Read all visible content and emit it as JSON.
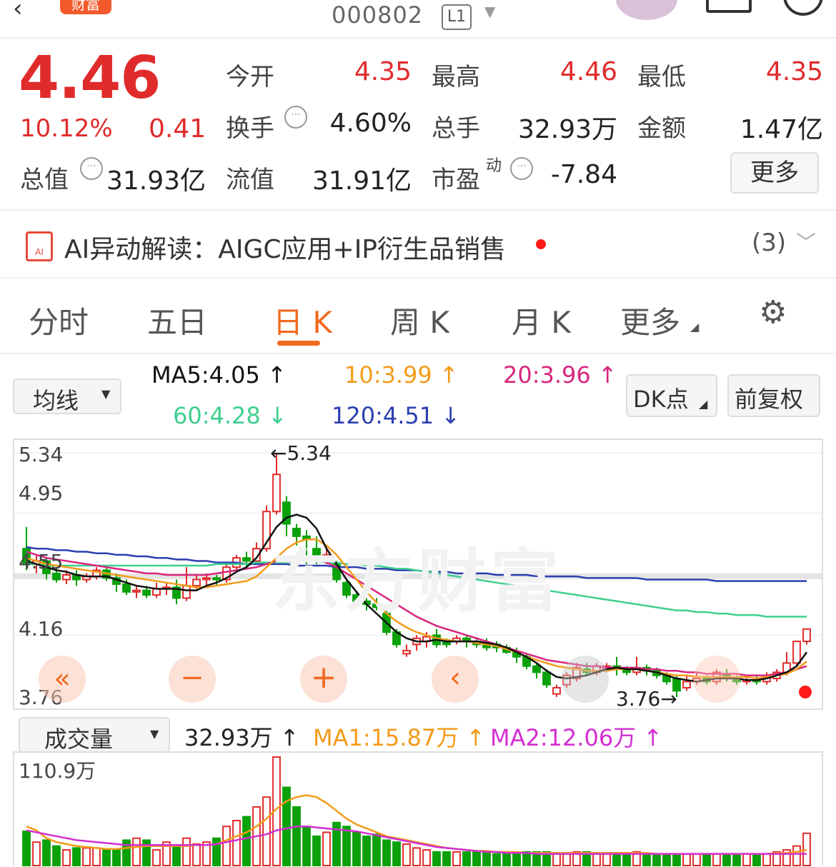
{
  "header": {
    "code": "000802",
    "level": "L1",
    "logo": "财富"
  },
  "quote": {
    "price": "4.46",
    "change_pct": "10.12%",
    "change": "0.41",
    "open_label": "今开",
    "open": "4.35",
    "high_label": "最高",
    "high": "4.46",
    "low_label": "最低",
    "low": "4.35",
    "turnover_label": "换手",
    "turnover": "4.60%",
    "volume_label": "总手",
    "volume": "32.93万",
    "amount_label": "金额",
    "amount": "1.47亿",
    "mktcap_label": "总值",
    "mktcap": "31.93亿",
    "float_label": "流值",
    "float_cap": "31.91亿",
    "pe_label": "市盈",
    "pe_sup": "动",
    "pe": "-7.84",
    "more": "更多"
  },
  "ai": {
    "label": "AI异动解读：",
    "text": "AIGC应用+IP衍生品销售",
    "count": "(3)"
  },
  "tabs": [
    "分时",
    "五日",
    "日 K",
    "周 K",
    "月 K",
    "更多"
  ],
  "active_tab": 2,
  "ma_bar": {
    "selector": "均线",
    "ma5": "MA5:4.05 ↑",
    "ma10": "10:3.99 ↑",
    "ma20": "20:3.96 ↑",
    "ma60": "60:4.28 ↓",
    "ma120": "120:4.51 ↓",
    "dk": "DK点",
    "fq": "前复权"
  },
  "price_axis": [
    "5.34",
    "4.95",
    "4.55",
    "4.16",
    "3.76"
  ],
  "price_annotations": {
    "high": "←5.34",
    "low": "3.76→"
  },
  "watermark": "东方财富",
  "volume_bar": {
    "selector": "成交量",
    "vol": "32.93万 ↑",
    "ma1": "MA1:15.87万 ↑",
    "ma2": "MA2:12.06万 ↑",
    "axis_max": "110.9万"
  },
  "colors": {
    "up": "#e02b2b",
    "down": "#0aa10a",
    "accent": "#f06a1f",
    "ma5": "#111111",
    "ma10": "#f39b19",
    "ma20": "#d8257e",
    "ma60": "#3fcf8e",
    "ma120": "#2b3fb0"
  },
  "chart_data": {
    "type": "candlestick",
    "ylim": [
      3.76,
      5.34
    ],
    "candles": [
      [
        4.72,
        4.62,
        4.86,
        4.58
      ],
      [
        4.62,
        4.64,
        4.68,
        4.56
      ],
      [
        4.64,
        4.56,
        4.66,
        4.52
      ],
      [
        4.56,
        4.52,
        4.6,
        4.5
      ],
      [
        4.52,
        4.55,
        4.58,
        4.49
      ],
      [
        4.55,
        4.52,
        4.58,
        4.48
      ],
      [
        4.52,
        4.54,
        4.56,
        4.5
      ],
      [
        4.54,
        4.58,
        4.6,
        4.52
      ],
      [
        4.58,
        4.53,
        4.6,
        4.51
      ],
      [
        4.53,
        4.49,
        4.56,
        4.44
      ],
      [
        4.49,
        4.44,
        4.52,
        4.42
      ],
      [
        4.44,
        4.45,
        4.48,
        4.4
      ],
      [
        4.45,
        4.42,
        4.48,
        4.4
      ],
      [
        4.42,
        4.46,
        4.5,
        4.4
      ],
      [
        4.46,
        4.47,
        4.5,
        4.42
      ],
      [
        4.47,
        4.4,
        4.52,
        4.36
      ],
      [
        4.4,
        4.48,
        4.6,
        4.38
      ],
      [
        4.48,
        4.52,
        4.55,
        4.46
      ],
      [
        4.52,
        4.53,
        4.56,
        4.48
      ],
      [
        4.53,
        4.52,
        4.55,
        4.48
      ],
      [
        4.52,
        4.6,
        4.62,
        4.5
      ],
      [
        4.6,
        4.66,
        4.68,
        4.58
      ],
      [
        4.66,
        4.64,
        4.7,
        4.6
      ],
      [
        4.64,
        4.72,
        4.76,
        4.62
      ],
      [
        4.72,
        4.96,
        5.0,
        4.7
      ],
      [
        4.96,
        5.2,
        5.34,
        4.94
      ],
      [
        5.02,
        4.88,
        5.06,
        4.8
      ],
      [
        4.85,
        4.8,
        4.88,
        4.74
      ],
      [
        4.8,
        4.78,
        4.84,
        4.62
      ],
      [
        4.72,
        4.66,
        4.8,
        4.62
      ],
      [
        4.66,
        4.68,
        4.72,
        4.62
      ],
      [
        4.62,
        4.52,
        4.64,
        4.5
      ],
      [
        4.5,
        4.42,
        4.52,
        4.4
      ],
      [
        4.42,
        4.38,
        4.44,
        4.36
      ],
      [
        4.38,
        4.36,
        4.4,
        4.32
      ],
      [
        4.36,
        4.34,
        4.4,
        4.32
      ],
      [
        4.3,
        4.18,
        4.32,
        4.16
      ],
      [
        4.18,
        4.1,
        4.2,
        4.08
      ],
      [
        4.04,
        4.06,
        4.1,
        4.02
      ],
      [
        4.1,
        4.14,
        4.16,
        4.06
      ],
      [
        4.12,
        4.15,
        4.18,
        4.08
      ],
      [
        4.16,
        4.1,
        4.2,
        4.08
      ],
      [
        4.12,
        4.1,
        4.14,
        4.08
      ],
      [
        4.12,
        4.14,
        4.16,
        4.1
      ],
      [
        4.14,
        4.12,
        4.16,
        4.08
      ],
      [
        4.12,
        4.1,
        4.14,
        4.08
      ],
      [
        4.1,
        4.08,
        4.14,
        4.06
      ],
      [
        4.1,
        4.08,
        4.12,
        4.05
      ],
      [
        4.08,
        4.05,
        4.1,
        4.04
      ],
      [
        4.05,
        4.02,
        4.08,
        3.98
      ],
      [
        4.02,
        3.96,
        4.04,
        3.94
      ],
      [
        3.96,
        3.92,
        3.98,
        3.88
      ],
      [
        3.92,
        3.84,
        3.94,
        3.82
      ],
      [
        3.78,
        3.82,
        3.84,
        3.76
      ],
      [
        3.84,
        3.9,
        3.92,
        3.82
      ],
      [
        3.88,
        3.95,
        3.98,
        3.86
      ],
      [
        3.94,
        3.92,
        3.98,
        3.9
      ],
      [
        3.92,
        3.96,
        3.98,
        3.9
      ],
      [
        3.94,
        3.96,
        3.98,
        3.92
      ],
      [
        3.96,
        3.94,
        4.02,
        3.9
      ],
      [
        3.94,
        3.92,
        3.96,
        3.9
      ],
      [
        3.92,
        3.95,
        4.02,
        3.9
      ],
      [
        3.95,
        3.93,
        3.97,
        3.9
      ],
      [
        3.93,
        3.9,
        3.95,
        3.88
      ],
      [
        3.9,
        3.86,
        3.92,
        3.84
      ],
      [
        3.88,
        3.8,
        3.9,
        3.76
      ],
      [
        3.82,
        3.86,
        3.9,
        3.8
      ],
      [
        3.86,
        3.88,
        3.92,
        3.84
      ],
      [
        3.88,
        3.86,
        3.9,
        3.84
      ],
      [
        3.86,
        3.92,
        3.94,
        3.84
      ],
      [
        3.9,
        3.88,
        3.94,
        3.86
      ],
      [
        3.88,
        3.86,
        3.9,
        3.84
      ],
      [
        3.86,
        3.87,
        3.9,
        3.84
      ],
      [
        3.87,
        3.86,
        3.9,
        3.84
      ],
      [
        3.86,
        3.9,
        3.92,
        3.84
      ],
      [
        3.88,
        3.92,
        3.94,
        3.86
      ],
      [
        3.92,
        3.98,
        4.05,
        3.9
      ],
      [
        3.98,
        4.12,
        4.12,
        3.96
      ],
      [
        4.12,
        4.2,
        4.2,
        4.1
      ]
    ],
    "ma5": [
      4.64,
      4.62,
      4.6,
      4.58,
      4.57,
      4.55,
      4.54,
      4.54,
      4.54,
      4.52,
      4.5,
      4.48,
      4.47,
      4.46,
      4.46,
      4.46,
      4.45,
      4.45,
      4.48,
      4.5,
      4.53,
      4.57,
      4.6,
      4.66,
      4.76,
      4.86,
      4.92,
      4.94,
      4.92,
      4.85,
      4.72,
      4.62,
      4.52,
      4.44,
      4.36,
      4.3,
      4.24,
      4.18,
      4.14,
      4.12,
      4.12,
      4.13,
      4.12,
      4.12,
      4.12,
      4.12,
      4.11,
      4.1,
      4.08,
      4.05,
      4.02,
      3.98,
      3.93,
      3.89,
      3.88,
      3.89,
      3.9,
      3.92,
      3.94,
      3.95,
      3.94,
      3.94,
      3.93,
      3.92,
      3.9,
      3.88,
      3.87,
      3.86,
      3.87,
      3.88,
      3.88,
      3.88,
      3.87,
      3.87,
      3.88,
      3.9,
      3.92,
      3.96,
      4.05
    ],
    "ma10": [
      4.66,
      4.64,
      4.62,
      4.61,
      4.6,
      4.59,
      4.58,
      4.57,
      4.56,
      4.55,
      4.54,
      4.53,
      4.52,
      4.51,
      4.5,
      4.49,
      4.48,
      4.47,
      4.47,
      4.48,
      4.49,
      4.5,
      4.51,
      4.54,
      4.6,
      4.66,
      4.72,
      4.76,
      4.78,
      4.78,
      4.74,
      4.68,
      4.6,
      4.52,
      4.44,
      4.37,
      4.3,
      4.25,
      4.21,
      4.18,
      4.16,
      4.14,
      4.13,
      4.12,
      4.12,
      4.11,
      4.1,
      4.09,
      4.07,
      4.05,
      4.02,
      4.0,
      3.98,
      3.96,
      3.95,
      3.94,
      3.93,
      3.93,
      3.93,
      3.94,
      3.94,
      3.94,
      3.93,
      3.92,
      3.91,
      3.9,
      3.9,
      3.89,
      3.89,
      3.89,
      3.89,
      3.89,
      3.89,
      3.88,
      3.89,
      3.9,
      3.91,
      3.94,
      3.99
    ],
    "ma20": [
      4.7,
      4.68,
      4.66,
      4.65,
      4.64,
      4.63,
      4.62,
      4.61,
      4.6,
      4.59,
      4.58,
      4.57,
      4.56,
      4.56,
      4.55,
      4.55,
      4.55,
      4.55,
      4.55,
      4.56,
      4.57,
      4.58,
      4.59,
      4.6,
      4.62,
      4.64,
      4.66,
      4.66,
      4.66,
      4.65,
      4.63,
      4.6,
      4.56,
      4.52,
      4.48,
      4.44,
      4.4,
      4.36,
      4.32,
      4.28,
      4.25,
      4.22,
      4.2,
      4.18,
      4.16,
      4.14,
      4.12,
      4.1,
      4.08,
      4.06,
      4.04,
      4.02,
      4.0,
      3.99,
      3.98,
      3.97,
      3.96,
      3.96,
      3.95,
      3.95,
      3.95,
      3.95,
      3.94,
      3.94,
      3.93,
      3.93,
      3.92,
      3.92,
      3.91,
      3.91,
      3.91,
      3.91,
      3.9,
      3.9,
      3.9,
      3.91,
      3.92,
      3.94,
      3.96
    ],
    "ma60": [
      4.62,
      4.62,
      4.61,
      4.61,
      4.61,
      4.61,
      4.61,
      4.61,
      4.61,
      4.61,
      4.61,
      4.61,
      4.61,
      4.61,
      4.61,
      4.61,
      4.61,
      4.61,
      4.61,
      4.62,
      4.62,
      4.62,
      4.62,
      4.63,
      4.63,
      4.63,
      4.63,
      4.64,
      4.64,
      4.64,
      4.63,
      4.63,
      4.62,
      4.62,
      4.61,
      4.61,
      4.6,
      4.59,
      4.59,
      4.58,
      4.57,
      4.56,
      4.55,
      4.54,
      4.53,
      4.52,
      4.51,
      4.5,
      4.49,
      4.48,
      4.47,
      4.46,
      4.45,
      4.44,
      4.43,
      4.42,
      4.41,
      4.4,
      4.39,
      4.38,
      4.37,
      4.36,
      4.35,
      4.34,
      4.33,
      4.32,
      4.32,
      4.31,
      4.31,
      4.3,
      4.3,
      4.29,
      4.29,
      4.29,
      4.28,
      4.28,
      4.28,
      4.28,
      4.28
    ],
    "ma120": [
      4.73,
      4.72,
      4.72,
      4.71,
      4.71,
      4.7,
      4.7,
      4.69,
      4.69,
      4.68,
      4.68,
      4.67,
      4.67,
      4.66,
      4.66,
      4.65,
      4.65,
      4.64,
      4.64,
      4.63,
      4.63,
      4.63,
      4.62,
      4.62,
      4.62,
      4.62,
      4.62,
      4.61,
      4.61,
      4.61,
      4.61,
      4.6,
      4.6,
      4.6,
      4.59,
      4.59,
      4.59,
      4.58,
      4.58,
      4.58,
      4.57,
      4.57,
      4.57,
      4.56,
      4.56,
      4.56,
      4.56,
      4.55,
      4.55,
      4.55,
      4.55,
      4.54,
      4.54,
      4.54,
      4.54,
      4.54,
      4.53,
      4.53,
      4.53,
      4.53,
      4.53,
      4.53,
      4.52,
      4.52,
      4.52,
      4.52,
      4.52,
      4.52,
      4.52,
      4.51,
      4.51,
      4.51,
      4.51,
      4.51,
      4.51,
      4.51,
      4.51,
      4.51,
      4.51
    ],
    "volume_wan": [
      35,
      24,
      26,
      20,
      16,
      18,
      18,
      18,
      16,
      16,
      26,
      28,
      26,
      16,
      24,
      20,
      28,
      22,
      24,
      28,
      40,
      46,
      50,
      60,
      70,
      111,
      80,
      60,
      40,
      30,
      34,
      44,
      40,
      34,
      30,
      32,
      26,
      24,
      22,
      18,
      16,
      14,
      14,
      14,
      14,
      14,
      14,
      12,
      12,
      12,
      14,
      14,
      14,
      12,
      12,
      14,
      14,
      12,
      12,
      12,
      12,
      14,
      12,
      12,
      12,
      12,
      12,
      12,
      12,
      12,
      12,
      12,
      12,
      12,
      12,
      14,
      16,
      20,
      33
    ],
    "volume_ma1": [
      40,
      36,
      28,
      24,
      22,
      20,
      19,
      18,
      17,
      17,
      18,
      19,
      20,
      20,
      20,
      20,
      20,
      21,
      21,
      22,
      26,
      30,
      34,
      40,
      48,
      58,
      66,
      70,
      72,
      70,
      64,
      56,
      48,
      42,
      38,
      34,
      30,
      28,
      26,
      24,
      22,
      20,
      18,
      17,
      16,
      15,
      15,
      14,
      14,
      14,
      13,
      13,
      13,
      13,
      13,
      13,
      13,
      13,
      13,
      13,
      13,
      13,
      13,
      12,
      12,
      12,
      12,
      12,
      12,
      12,
      12,
      12,
      12,
      12,
      12,
      13,
      13,
      14,
      16
    ],
    "volume_ma2": [
      36,
      34,
      32,
      30,
      28,
      26,
      25,
      24,
      23,
      22,
      21,
      21,
      21,
      21,
      21,
      21,
      21,
      21,
      21,
      22,
      24,
      26,
      28,
      30,
      32,
      36,
      38,
      40,
      40,
      39,
      38,
      37,
      36,
      35,
      33,
      31,
      29,
      27,
      25,
      23,
      21,
      19,
      18,
      17,
      16,
      15,
      14,
      14,
      13,
      13,
      13,
      12,
      12,
      12,
      12,
      12,
      12,
      12,
      12,
      12,
      12,
      12,
      12,
      12,
      12,
      12,
      12,
      12,
      12,
      12,
      12,
      12,
      12,
      12,
      12,
      12,
      12,
      12,
      12
    ]
  }
}
